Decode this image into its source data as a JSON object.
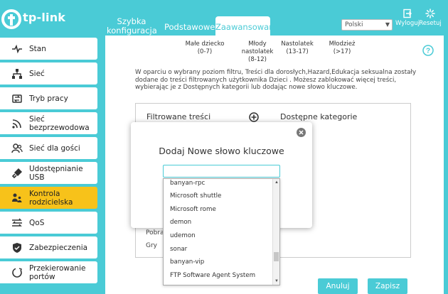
{
  "header": {
    "logo_text": "tp-link",
    "tabs": [
      {
        "label_line1": "Szybka",
        "label_line2": "konfiguracja"
      },
      {
        "label": "Podstawowe"
      },
      {
        "label": "Zaawansowane"
      }
    ],
    "language": "Polski",
    "logout_label": "Wyloguj",
    "reboot_label": "Resetuj"
  },
  "sidebar": {
    "items": [
      {
        "label": "Stan",
        "icon": "pulse-icon"
      },
      {
        "label": "Sieć",
        "icon": "network-icon"
      },
      {
        "label": "Tryb pracy",
        "icon": "mode-icon"
      },
      {
        "label": "Sieć bezprzewodowa",
        "icon": "wifi-icon"
      },
      {
        "label": "Sieć dla gości",
        "icon": "guests-icon"
      },
      {
        "label": "Udostępnianie USB",
        "icon": "usb-icon"
      },
      {
        "label": "Kontrola rodzicielska",
        "icon": "parental-icon"
      },
      {
        "label": "QoS",
        "icon": "qos-icon"
      },
      {
        "label": "Zabezpieczenia",
        "icon": "shield-icon"
      },
      {
        "label_line1": "Przekierowanie",
        "label_line2": "portów",
        "icon": "forwarding-icon"
      }
    ]
  },
  "levels": [
    {
      "name": "Małe dziecko",
      "range": "(0-7)"
    },
    {
      "name": "Młody nastolatek",
      "range": "(8-12)"
    },
    {
      "name": "Nastolatek",
      "range": "(13-17)"
    },
    {
      "name": "Młodzież",
      "range": "(>17)"
    }
  ],
  "description": "W oparciu o wybrany poziom filtru, Treści dla dorosłych,Hazard,Edukacja seksualna zostały dodane do treści filtrowanych użytkownika Dzieci . Możesz zablokować więcej treści, wybierając je z Dostępnych kategorii lub dodając nowe słowo kluczowe.",
  "filter": {
    "filtered_title": "Filtrowane treści",
    "available_title": "Dostępne kategorie",
    "behind_items": [
      "Pobrar",
      "Gry"
    ]
  },
  "buttons": {
    "cancel": "Anuluj",
    "save": "Zapisz"
  },
  "dialog": {
    "title": "Dodaj Nowe słowo kluczowe",
    "input_value": "",
    "suggestions": [
      "banyan-rpc",
      "Microsoft shuttle",
      "Microsoft rome",
      "demon",
      "udemon",
      "sonar",
      "banyan-vip",
      "FTP Software Agent System"
    ]
  },
  "colors": {
    "accent": "#4acbd6",
    "active_menu": "#f7c21a"
  }
}
